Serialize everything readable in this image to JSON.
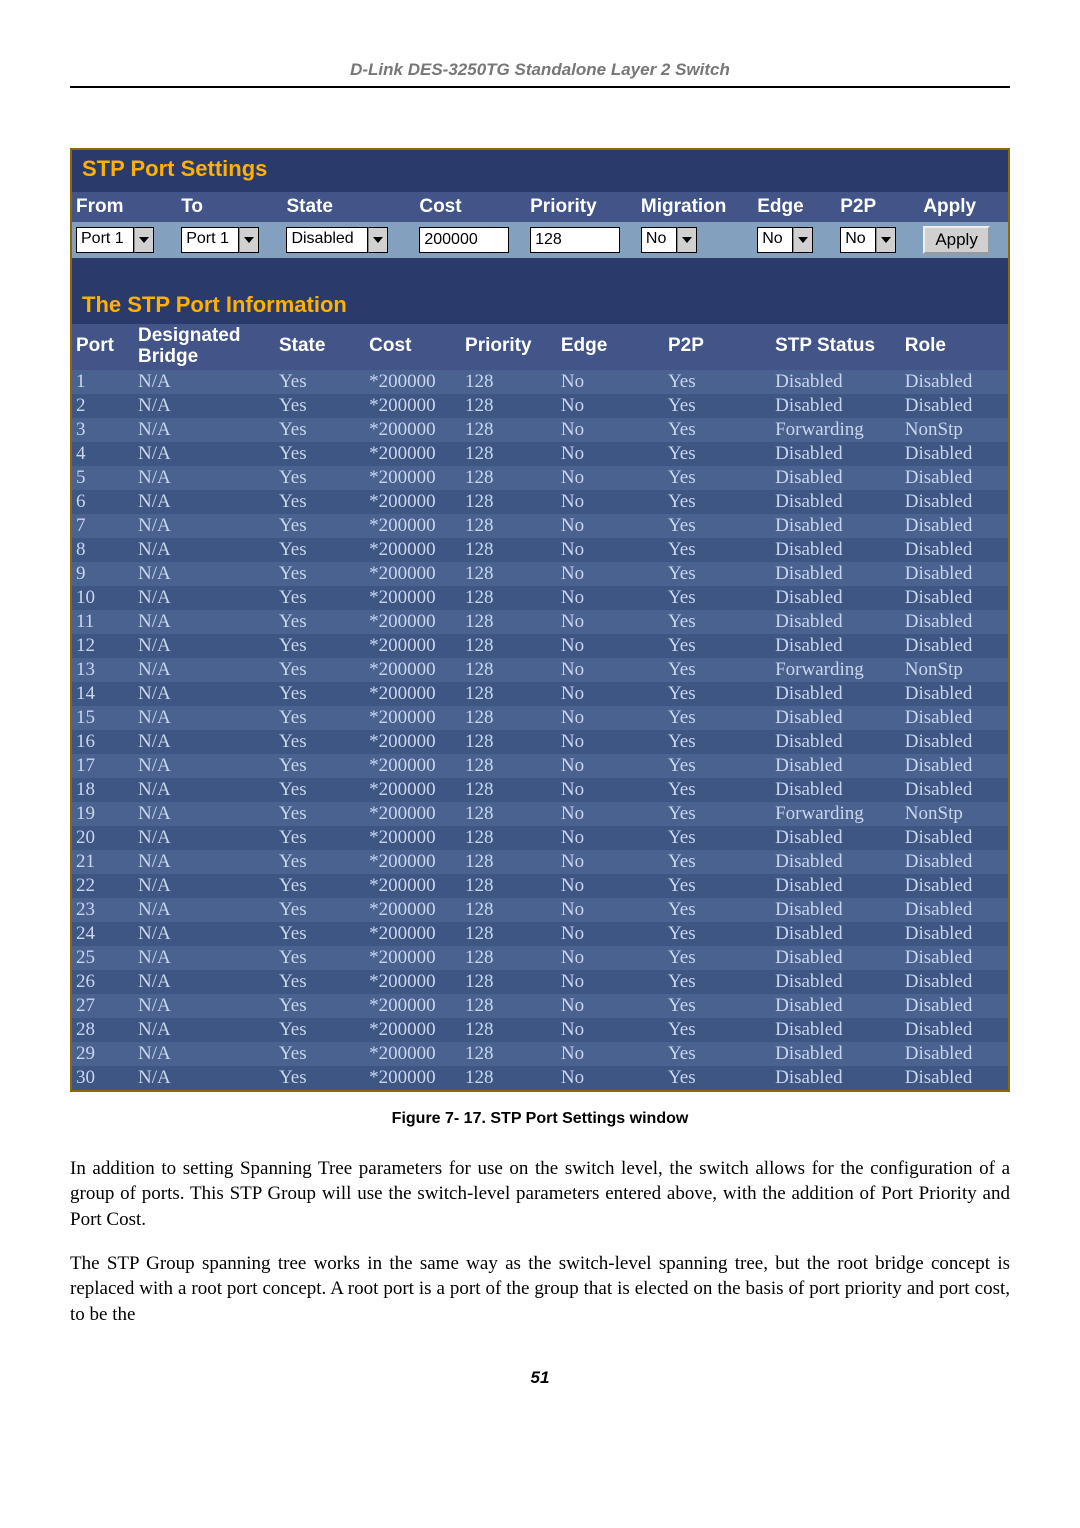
{
  "doc_header": "D-Link DES-3250TG Standalone Layer 2 Switch",
  "panel": {
    "title": "STP Port Settings",
    "controls": {
      "headers": [
        "From",
        "To",
        "State",
        "Cost",
        "Priority",
        "Migration",
        "Edge",
        "P2P",
        "Apply"
      ],
      "from_value": "Port 1",
      "to_value": "Port 1",
      "state_value": "Disabled",
      "cost_value": "200000",
      "priority_value": "128",
      "migration_value": "No",
      "edge_value": "No",
      "p2p_value": "No",
      "apply_label": "Apply"
    },
    "info_title": "The STP Port Information",
    "info_headers": [
      "Port",
      "Designated Bridge",
      "State",
      "Cost",
      "Priority",
      "Edge",
      "P2P",
      "STP Status",
      "Role"
    ],
    "info_rows": [
      {
        "port": "1",
        "db": "N/A",
        "state": "Yes",
        "cost": "*200000",
        "pri": "128",
        "edge": "No",
        "p2p": "Yes",
        "stp": "Disabled",
        "role": "Disabled"
      },
      {
        "port": "2",
        "db": "N/A",
        "state": "Yes",
        "cost": "*200000",
        "pri": "128",
        "edge": "No",
        "p2p": "Yes",
        "stp": "Disabled",
        "role": "Disabled"
      },
      {
        "port": "3",
        "db": "N/A",
        "state": "Yes",
        "cost": "*200000",
        "pri": "128",
        "edge": "No",
        "p2p": "Yes",
        "stp": "Forwarding",
        "role": "NonStp"
      },
      {
        "port": "4",
        "db": "N/A",
        "state": "Yes",
        "cost": "*200000",
        "pri": "128",
        "edge": "No",
        "p2p": "Yes",
        "stp": "Disabled",
        "role": "Disabled"
      },
      {
        "port": "5",
        "db": "N/A",
        "state": "Yes",
        "cost": "*200000",
        "pri": "128",
        "edge": "No",
        "p2p": "Yes",
        "stp": "Disabled",
        "role": "Disabled"
      },
      {
        "port": "6",
        "db": "N/A",
        "state": "Yes",
        "cost": "*200000",
        "pri": "128",
        "edge": "No",
        "p2p": "Yes",
        "stp": "Disabled",
        "role": "Disabled"
      },
      {
        "port": "7",
        "db": "N/A",
        "state": "Yes",
        "cost": "*200000",
        "pri": "128",
        "edge": "No",
        "p2p": "Yes",
        "stp": "Disabled",
        "role": "Disabled"
      },
      {
        "port": "8",
        "db": "N/A",
        "state": "Yes",
        "cost": "*200000",
        "pri": "128",
        "edge": "No",
        "p2p": "Yes",
        "stp": "Disabled",
        "role": "Disabled"
      },
      {
        "port": "9",
        "db": "N/A",
        "state": "Yes",
        "cost": "*200000",
        "pri": "128",
        "edge": "No",
        "p2p": "Yes",
        "stp": "Disabled",
        "role": "Disabled"
      },
      {
        "port": "10",
        "db": "N/A",
        "state": "Yes",
        "cost": "*200000",
        "pri": "128",
        "edge": "No",
        "p2p": "Yes",
        "stp": "Disabled",
        "role": "Disabled"
      },
      {
        "port": "11",
        "db": "N/A",
        "state": "Yes",
        "cost": "*200000",
        "pri": "128",
        "edge": "No",
        "p2p": "Yes",
        "stp": "Disabled",
        "role": "Disabled"
      },
      {
        "port": "12",
        "db": "N/A",
        "state": "Yes",
        "cost": "*200000",
        "pri": "128",
        "edge": "No",
        "p2p": "Yes",
        "stp": "Disabled",
        "role": "Disabled"
      },
      {
        "port": "13",
        "db": "N/A",
        "state": "Yes",
        "cost": "*200000",
        "pri": "128",
        "edge": "No",
        "p2p": "Yes",
        "stp": "Forwarding",
        "role": "NonStp"
      },
      {
        "port": "14",
        "db": "N/A",
        "state": "Yes",
        "cost": "*200000",
        "pri": "128",
        "edge": "No",
        "p2p": "Yes",
        "stp": "Disabled",
        "role": "Disabled"
      },
      {
        "port": "15",
        "db": "N/A",
        "state": "Yes",
        "cost": "*200000",
        "pri": "128",
        "edge": "No",
        "p2p": "Yes",
        "stp": "Disabled",
        "role": "Disabled"
      },
      {
        "port": "16",
        "db": "N/A",
        "state": "Yes",
        "cost": "*200000",
        "pri": "128",
        "edge": "No",
        "p2p": "Yes",
        "stp": "Disabled",
        "role": "Disabled"
      },
      {
        "port": "17",
        "db": "N/A",
        "state": "Yes",
        "cost": "*200000",
        "pri": "128",
        "edge": "No",
        "p2p": "Yes",
        "stp": "Disabled",
        "role": "Disabled"
      },
      {
        "port": "18",
        "db": "N/A",
        "state": "Yes",
        "cost": "*200000",
        "pri": "128",
        "edge": "No",
        "p2p": "Yes",
        "stp": "Disabled",
        "role": "Disabled"
      },
      {
        "port": "19",
        "db": "N/A",
        "state": "Yes",
        "cost": "*200000",
        "pri": "128",
        "edge": "No",
        "p2p": "Yes",
        "stp": "Forwarding",
        "role": "NonStp"
      },
      {
        "port": "20",
        "db": "N/A",
        "state": "Yes",
        "cost": "*200000",
        "pri": "128",
        "edge": "No",
        "p2p": "Yes",
        "stp": "Disabled",
        "role": "Disabled"
      },
      {
        "port": "21",
        "db": "N/A",
        "state": "Yes",
        "cost": "*200000",
        "pri": "128",
        "edge": "No",
        "p2p": "Yes",
        "stp": "Disabled",
        "role": "Disabled"
      },
      {
        "port": "22",
        "db": "N/A",
        "state": "Yes",
        "cost": "*200000",
        "pri": "128",
        "edge": "No",
        "p2p": "Yes",
        "stp": "Disabled",
        "role": "Disabled"
      },
      {
        "port": "23",
        "db": "N/A",
        "state": "Yes",
        "cost": "*200000",
        "pri": "128",
        "edge": "No",
        "p2p": "Yes",
        "stp": "Disabled",
        "role": "Disabled"
      },
      {
        "port": "24",
        "db": "N/A",
        "state": "Yes",
        "cost": "*200000",
        "pri": "128",
        "edge": "No",
        "p2p": "Yes",
        "stp": "Disabled",
        "role": "Disabled"
      },
      {
        "port": "25",
        "db": "N/A",
        "state": "Yes",
        "cost": "*200000",
        "pri": "128",
        "edge": "No",
        "p2p": "Yes",
        "stp": "Disabled",
        "role": "Disabled"
      },
      {
        "port": "26",
        "db": "N/A",
        "state": "Yes",
        "cost": "*200000",
        "pri": "128",
        "edge": "No",
        "p2p": "Yes",
        "stp": "Disabled",
        "role": "Disabled"
      },
      {
        "port": "27",
        "db": "N/A",
        "state": "Yes",
        "cost": "*200000",
        "pri": "128",
        "edge": "No",
        "p2p": "Yes",
        "stp": "Disabled",
        "role": "Disabled"
      },
      {
        "port": "28",
        "db": "N/A",
        "state": "Yes",
        "cost": "*200000",
        "pri": "128",
        "edge": "No",
        "p2p": "Yes",
        "stp": "Disabled",
        "role": "Disabled"
      },
      {
        "port": "29",
        "db": "N/A",
        "state": "Yes",
        "cost": "*200000",
        "pri": "128",
        "edge": "No",
        "p2p": "Yes",
        "stp": "Disabled",
        "role": "Disabled"
      },
      {
        "port": "30",
        "db": "N/A",
        "state": "Yes",
        "cost": "*200000",
        "pri": "128",
        "edge": "No",
        "p2p": "Yes",
        "stp": "Disabled",
        "role": "Disabled"
      }
    ]
  },
  "figure_caption": "Figure 7- 17.  STP Port Settings window",
  "para1": "In addition to setting Spanning Tree parameters for use on the switch level, the switch allows for the configuration of a group of ports. This STP Group will use the switch-level parameters entered above, with the addition of Port Priority and Port Cost.",
  "para2": "The STP Group spanning tree works in the same way as the switch-level spanning tree, but the root bridge concept is replaced with a root port concept. A root port is a port of the group that is elected on the basis of port priority and port cost, to be the",
  "page_number": "51"
}
